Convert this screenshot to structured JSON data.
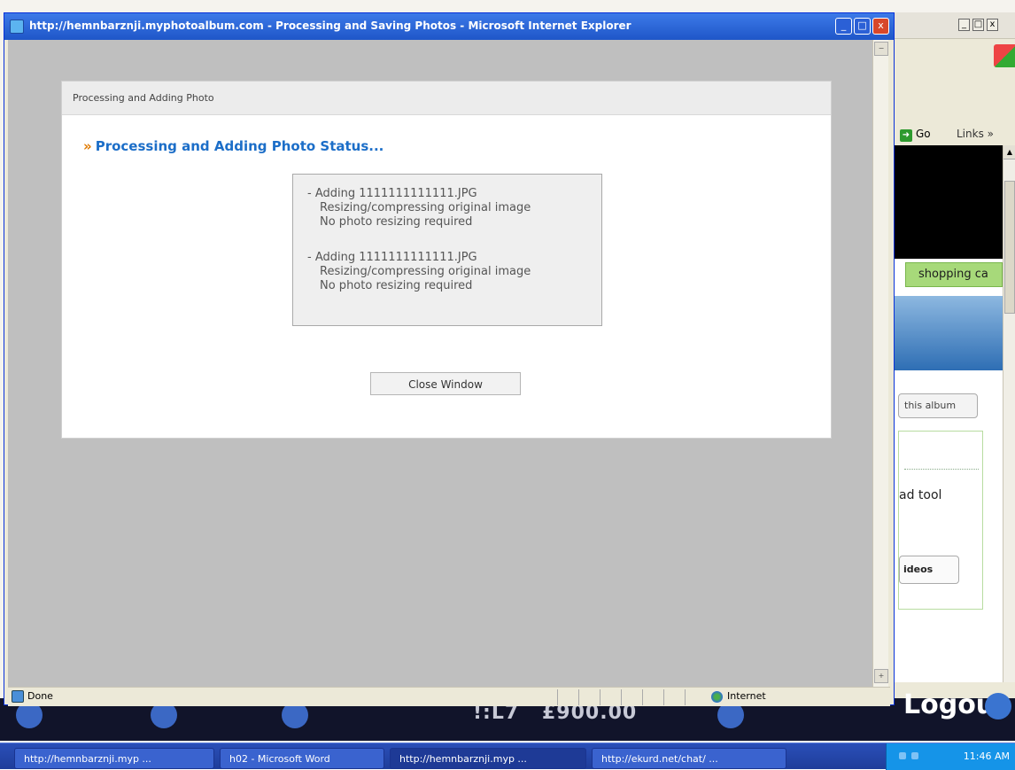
{
  "ie_window": {
    "title": "http://hemnbarznji.myphotoalbum.com - Processing and Saving Photos - Microsoft Internet Explorer",
    "minimize": "_",
    "maximize": "□",
    "close": "x"
  },
  "dialog": {
    "header": "Processing and Adding Photo",
    "status_title": "Processing and Adding Photo Status...",
    "bullet": "»",
    "log": [
      {
        "line1": "- Adding 1111111111111.JPG",
        "line2": "Resizing/compressing original image",
        "line3": "No photo resizing required"
      },
      {
        "line1": "- Adding 1111111111111.JPG",
        "line2": "Resizing/compressing original image",
        "line3": "No photo resizing required"
      }
    ],
    "close_button": "Close Window"
  },
  "ie_status": {
    "text": "Done",
    "zone": "Internet"
  },
  "bg_window": {
    "go": "Go",
    "links": "Links »",
    "tab": "shopping ca",
    "album_button": "this album",
    "upload_text": "ad tool",
    "videos_button": "ideos",
    "logout": "Logout"
  },
  "banner": {
    "items": [
      "...",
      "!:L7",
      "£900.00"
    ]
  },
  "taskbar": {
    "items": [
      "http://hemnbarznji.myp ...",
      "h02 - Microsoft Word",
      "http://hemnbarznji.myp ...",
      "http://ekurd.net/chat/ ..."
    ],
    "clock": "11:46 AM"
  },
  "colors": {
    "titlebar": "#1f56c8",
    "accent_blue": "#1c6ec8",
    "bullet_orange": "#e07a00",
    "taskbar": "#2a4fb8"
  }
}
